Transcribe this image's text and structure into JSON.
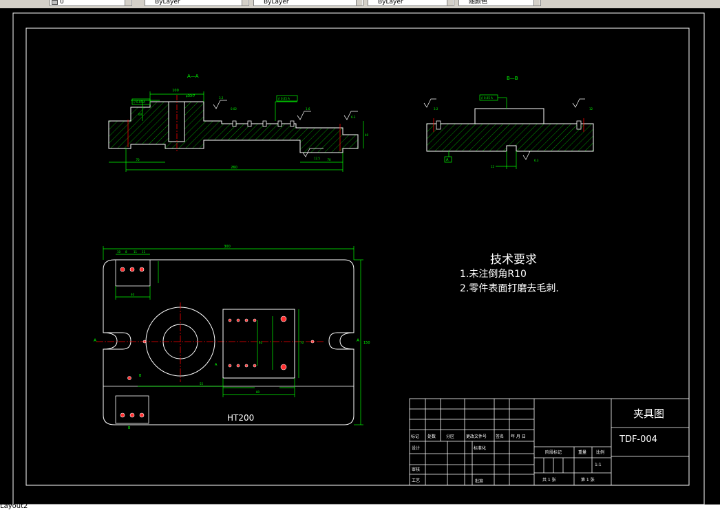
{
  "toolbar": {
    "fields": [
      {
        "name": "layer-select",
        "value": "0"
      },
      {
        "name": "color-select",
        "value": "ByLayer"
      },
      {
        "name": "linetype-select",
        "value": "ByLayer"
      },
      {
        "name": "lineweight-select",
        "value": "ByLayer"
      },
      {
        "name": "plotstyle-select",
        "value": "随颜色"
      }
    ]
  },
  "drawing": {
    "section_aa": {
      "title": "A—A",
      "dims": {
        "d1": "100",
        "d2": "φ30H7",
        "d3": "260",
        "d4": "70",
        "d5": "70",
        "d6": "40",
        "d7": "60"
      },
      "tolerances": {
        "t1": "// 0.05 A",
        "t2": "// 0.05 A",
        "t3": "0.02"
      },
      "roughness": {
        "r1": "3.2",
        "r2": "1.6",
        "r3": "6.3",
        "r4": "12.5"
      }
    },
    "section_bb": {
      "title": "B—B",
      "tolerances": {
        "t1": "// 0.05 A"
      },
      "roughness": {
        "r1": "3.2",
        "r2": "6.3"
      },
      "datum": "A",
      "dims": {
        "d1": "12",
        "d2": "12"
      }
    },
    "plan_view": {
      "dims": {
        "overall_width": "300",
        "overall_height": "150",
        "d1": "10",
        "d2": "8",
        "d3": "11",
        "d4": "11",
        "d5": "40",
        "d6": "80",
        "d7": "55",
        "d8": "40",
        "d9": "70"
      },
      "section_marks": {
        "a_left": "A",
        "a_right": "A",
        "a_center": "A",
        "b_top": "B",
        "b_bottom": "B"
      },
      "material": "HT200"
    },
    "tech_requirements": {
      "title": "技术要求",
      "items": [
        "1.未注倒角R10",
        "2.零件表面打磨去毛刺."
      ]
    },
    "title_block": {
      "drawing_name": "夹具图",
      "drawing_number": "TDF-004",
      "labels": {
        "mark": "标记",
        "count": "处数",
        "zone": "分区",
        "doc_no": "更改文件号",
        "sign": "签名",
        "date": "年 月 日",
        "design": "设计",
        "standard": "标准化",
        "review": "审核",
        "process": "工艺",
        "approve": "批准",
        "stage": "阶段标记",
        "weight": "重量",
        "scale": "比例",
        "scale_value": "1:1",
        "sheets_total": "共 1 张",
        "sheet_no": "第 1 张"
      }
    }
  },
  "status": {
    "layout_tab": "Layout2"
  },
  "colors": {
    "background": "#000000",
    "lines": "#ffffff",
    "dims": "#00ff00",
    "centerline": "#ff0000",
    "tolerance": "#00ff00"
  }
}
